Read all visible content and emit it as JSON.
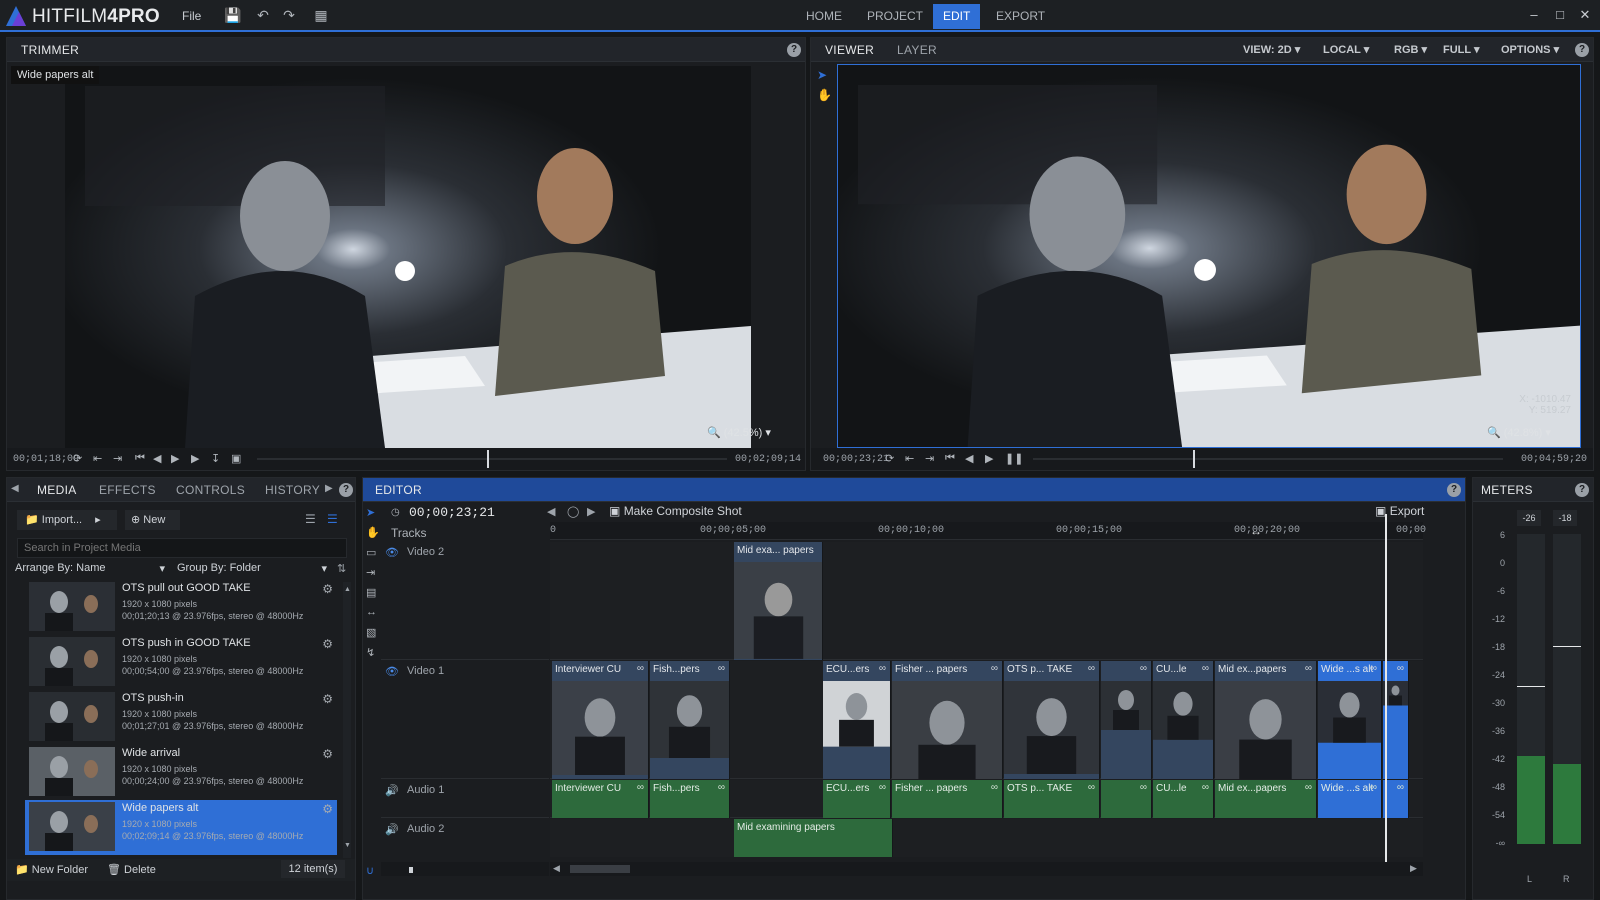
{
  "app": {
    "brand_main": "HITFILM",
    "brand_suffix": "4PRO"
  },
  "menu": {
    "file": "File"
  },
  "nav": {
    "home": "HOME",
    "project": "PROJECT",
    "edit": "EDIT",
    "export": "EXPORT"
  },
  "trimmer": {
    "tab": "TRIMMER",
    "clip_label": "Wide papers alt",
    "zoom": "(42.5%)",
    "time_in": "00;01;18;09",
    "time_out": "00;02;09;14",
    "playhead_fraction": 0.49
  },
  "viewer": {
    "tabs": [
      "VIEWER",
      "LAYER"
    ],
    "dropdowns": [
      "VIEW: 2D",
      "LOCAL",
      "RGB",
      "FULL",
      "OPTIONS"
    ],
    "coords_x": "X: -1010.47",
    "coords_y": "Y:  519.27",
    "zoom": "(42.8%)",
    "time_in": "00;00;23;21",
    "time_out": "00;04;59;20",
    "playhead_fraction": 0.34
  },
  "media_panel": {
    "tabs": [
      "MEDIA",
      "EFFECTS",
      "CONTROLS",
      "HISTORY"
    ],
    "import_label": "Import...",
    "new_label": "New",
    "search_placeholder": "Search in Project Media",
    "arrange_label": "Arrange By: Name",
    "group_label": "Group By: Folder",
    "items": [
      {
        "name": "OTS pull out GOOD TAKE",
        "dims": "1920 x 1080 pixels",
        "info": "00;01;20;13 @ 23.976fps, stereo @ 48000Hz"
      },
      {
        "name": "OTS push in GOOD TAKE",
        "dims": "1920 x 1080 pixels",
        "info": "00;00;54;00 @ 23.976fps, stereo @ 48000Hz"
      },
      {
        "name": "OTS push-in",
        "dims": "1920 x 1080 pixels",
        "info": "00;01;27;01 @ 23.976fps, stereo @ 48000Hz"
      },
      {
        "name": "Wide arrival",
        "dims": "1920 x 1080 pixels",
        "info": "00;00;24;00 @ 23.976fps, stereo @ 48000Hz"
      },
      {
        "name": "Wide papers alt",
        "dims": "1920 x 1080 pixels",
        "info": "00;02;09;14 @ 23.976fps, stereo @ 48000Hz"
      }
    ],
    "new_folder": "New Folder",
    "delete": "Delete",
    "count": "12 item(s)"
  },
  "editor": {
    "tab": "EDITOR",
    "timecode": "00;00;23;21",
    "composite": "Make Composite Shot",
    "export": "Export",
    "tracks_label": "Tracks",
    "ruler": [
      "0",
      "00;00;05;00",
      "00;00;10;00",
      "00;00;15;00",
      "00;00;20;00",
      "00;00"
    ],
    "tracks": [
      "Video 2",
      "Video 1",
      "Audio 1",
      "Audio 2"
    ],
    "video2_clip": "Mid exa... papers",
    "video1_clips": [
      "Interviewer CU",
      "Fish...pers",
      "ECU...ers",
      "Fisher ... papers",
      "OTS p... TAKE",
      "",
      "CU...le",
      "Mid ex...papers",
      "Wide ...s alt",
      ""
    ],
    "audio1_clips": [
      "Interviewer CU",
      "Fish...pers",
      "ECU...ers",
      "Fisher ... papers",
      "OTS p... TAKE",
      "",
      "CU...le",
      "Mid ex...papers",
      "Wide ...s alt",
      ""
    ],
    "audio2_clip": "Mid examining papers"
  },
  "meters": {
    "tab": "METERS",
    "top": [
      "-26",
      "-18"
    ],
    "scale": [
      "6",
      "0",
      "-6",
      "-12",
      "-18",
      "-24",
      "-30",
      "-36",
      "-42",
      "-48",
      "-54",
      "-∞"
    ],
    "channels": [
      "L",
      "R"
    ]
  },
  "colors": {
    "accent": "#2f6fd6",
    "video_clip": "#34465f",
    "audio_clip": "#2d6a3c"
  }
}
